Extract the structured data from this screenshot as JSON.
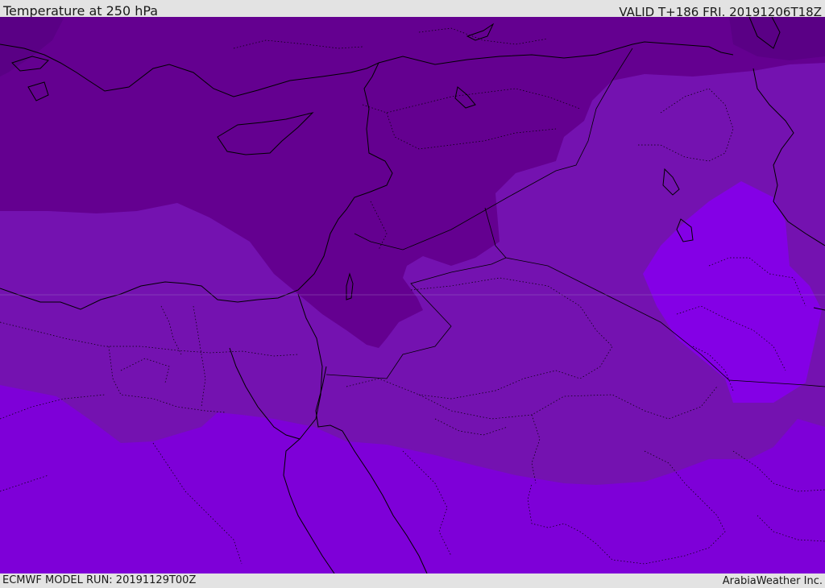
{
  "header": {
    "title": "Temperature at 250 hPa",
    "valid": "VALID T+186 FRI. 20191206T18Z"
  },
  "footer": {
    "model_run": "ECMWF MODEL RUN: 20191129T00Z",
    "credit": "ArabiaWeather Inc."
  },
  "colors": {
    "dark_band": "#640090",
    "mid_band": "#7412b0",
    "light_band": "#7e00d8",
    "bright_band": "#8400e6",
    "coast": "#000000"
  }
}
